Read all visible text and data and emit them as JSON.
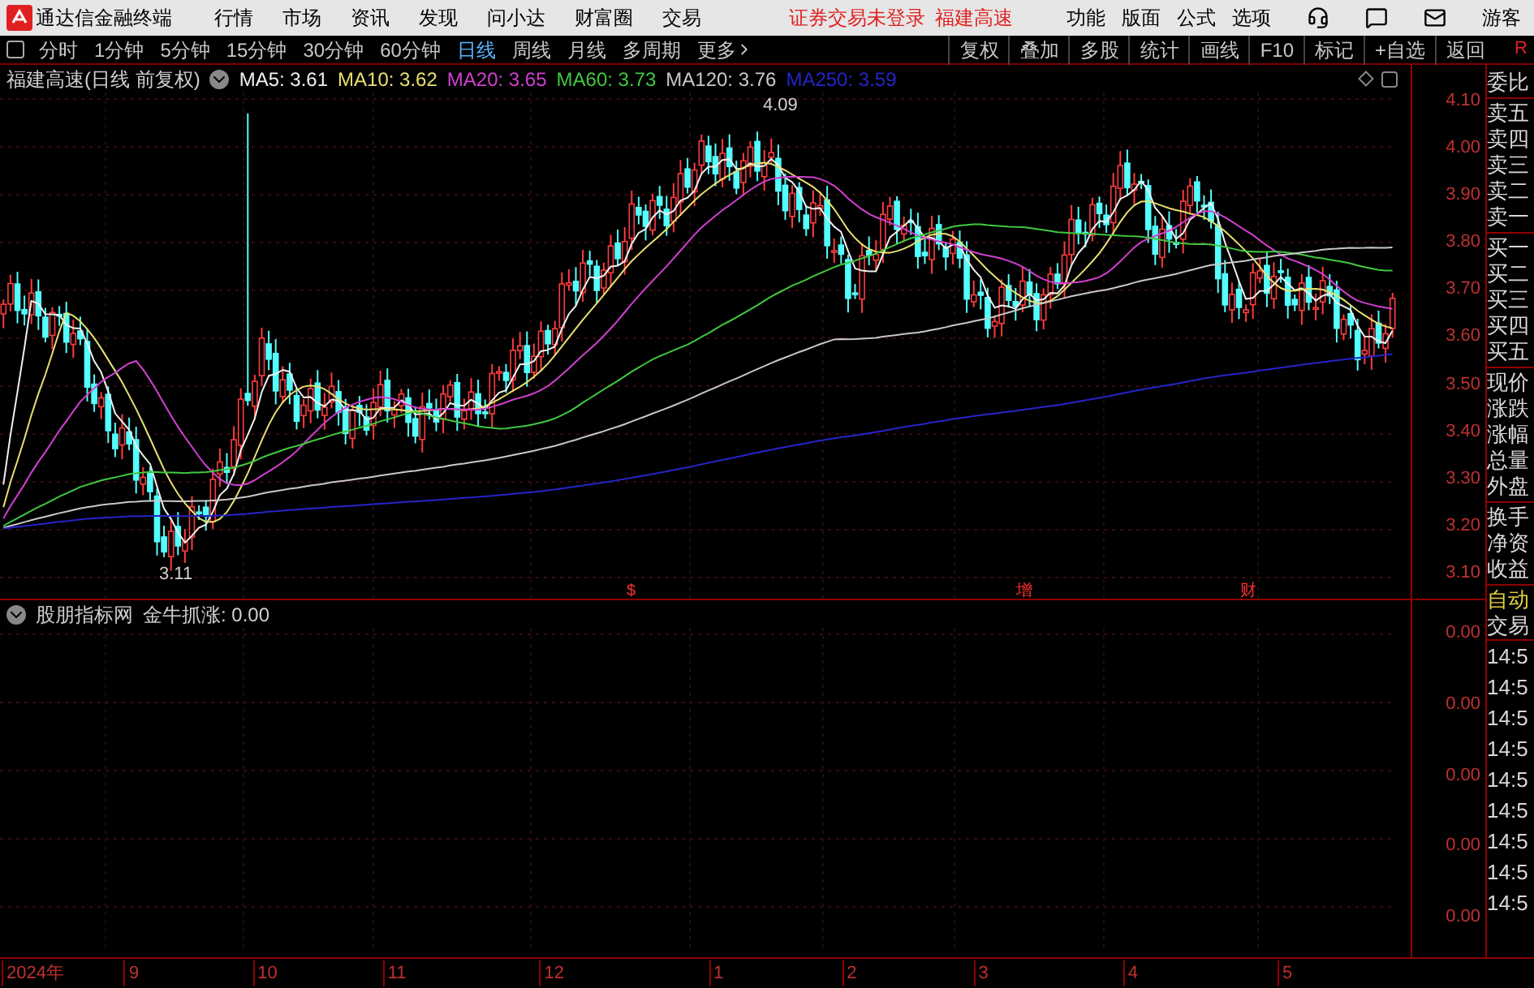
{
  "app": {
    "title": "通达信金融终端",
    "menu": [
      "行情",
      "市场",
      "资讯",
      "发现",
      "问小达",
      "财富圈",
      "交易"
    ],
    "login_status": "证券交易未登录",
    "stock_link": "福建高速",
    "right_menu": [
      "功能",
      "版面",
      "公式",
      "选项"
    ],
    "user": "游客"
  },
  "periods": [
    {
      "label": "分时",
      "selected": false
    },
    {
      "label": "1分钟",
      "selected": false
    },
    {
      "label": "5分钟",
      "selected": false
    },
    {
      "label": "15分钟",
      "selected": false
    },
    {
      "label": "30分钟",
      "selected": false
    },
    {
      "label": "60分钟",
      "selected": false
    },
    {
      "label": "日线",
      "selected": true
    },
    {
      "label": "周线",
      "selected": false
    },
    {
      "label": "月线",
      "selected": false
    },
    {
      "label": "多周期",
      "selected": false
    },
    {
      "label": "更多",
      "selected": false
    }
  ],
  "tools": [
    "复权",
    "叠加",
    "多股",
    "统计",
    "画线",
    "F10",
    "标记",
    "+自选",
    "返回"
  ],
  "corner_mark": "R",
  "chart": {
    "title": "福建高速(日线 前复权)",
    "ma": [
      {
        "label": "MA5: 3.61",
        "color": "#f0f0f0"
      },
      {
        "label": "MA10: 3.62",
        "color": "#e8e070"
      },
      {
        "label": "MA20: 3.65",
        "color": "#d040d0"
      },
      {
        "label": "MA60: 3.73",
        "color": "#40c840"
      },
      {
        "label": "MA120: 3.76",
        "color": "#c8c8c8"
      },
      {
        "label": "MA250: 3.59",
        "color": "#2424c8"
      }
    ],
    "high_label": "4.09",
    "low_label": "3.11",
    "markers": [
      "$",
      "增",
      "财"
    ],
    "price_ticks": [
      "4.10",
      "4.00",
      "3.90",
      "3.80",
      "3.70",
      "3.60",
      "3.50",
      "3.40",
      "3.30",
      "3.20",
      "3.10"
    ]
  },
  "indicator": {
    "name": "股朋指标网",
    "reading": "金牛抓涨: 0.00",
    "ticks": [
      "0.00",
      "0.00",
      "0.00",
      "0.00",
      "0.00"
    ]
  },
  "quote_panel": {
    "groups": [
      [
        "委比"
      ],
      [
        "卖五",
        "卖四",
        "卖三",
        "卖二",
        "卖一"
      ],
      [
        "买一",
        "买二",
        "买三",
        "买四",
        "买五"
      ],
      [
        "现价",
        "涨跌",
        "涨幅",
        "总量",
        "外盘"
      ],
      [
        "换手",
        "净资",
        "收益"
      ]
    ],
    "auto": "自动",
    "trade": "交易",
    "times": [
      "14:5",
      "14:5",
      "14:5",
      "14:5",
      "14:5",
      "14:5",
      "14:5",
      "14:5",
      "14:5"
    ]
  },
  "date_axis": [
    "2024年",
    "9",
    "10",
    "11",
    "12",
    "1",
    "2",
    "3",
    "4",
    "5"
  ]
}
